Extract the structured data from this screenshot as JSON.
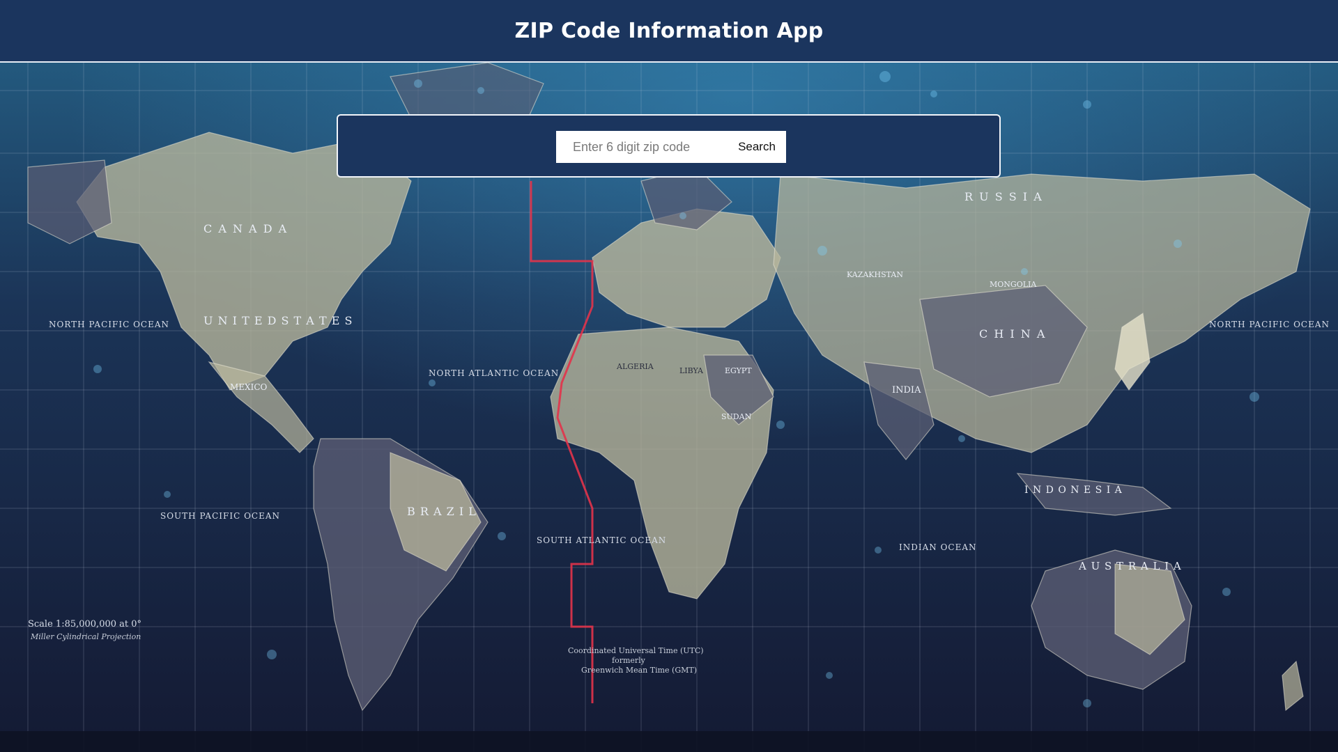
{
  "header": {
    "title": "ZIP Code Information App"
  },
  "search": {
    "placeholder": "Enter 6 digit zip code",
    "value": "",
    "button_label": "Search"
  },
  "map": {
    "labels": {
      "canada": "C A N A D A",
      "united_states": "U N I T E D   S T A T E S",
      "mexico": "MEXICO",
      "brazil": "B R A Z I L",
      "russia": "R U S S I A",
      "china": "C H I N A",
      "india": "INDIA",
      "australia": "A U S T R A L I A",
      "indonesia": "I N D O N E S I A",
      "kazakhstan": "KAZAKHSTAN",
      "mongolia": "MONGOLIA",
      "algeria": "ALGERIA",
      "libya": "LIBYA",
      "egypt": "EGYPT",
      "sudan": "SUDAN",
      "north_pacific": "NORTH PACIFIC OCEAN",
      "south_pacific": "SOUTH PACIFIC OCEAN",
      "north_atlantic": "NORTH ATLANTIC OCEAN",
      "south_atlantic": "SOUTH ATLANTIC OCEAN",
      "indian_ocean": "INDIAN OCEAN",
      "scale": "Scale 1:85,000,000 at 0°",
      "projection": "Miller Cylindrical Projection",
      "utc": "Coordinated Universal Time (UTC)",
      "utc_formerly": "formerly",
      "utc_gmt": "Greenwich Mean Time (GMT)"
    },
    "colors": {
      "ocean_top": "#23597e",
      "ocean_bottom": "#141a33",
      "land": "#b9b79c",
      "land_dark": "#5a5d73",
      "grid": "#c9d3e3",
      "dateline": "#e2334a"
    }
  }
}
